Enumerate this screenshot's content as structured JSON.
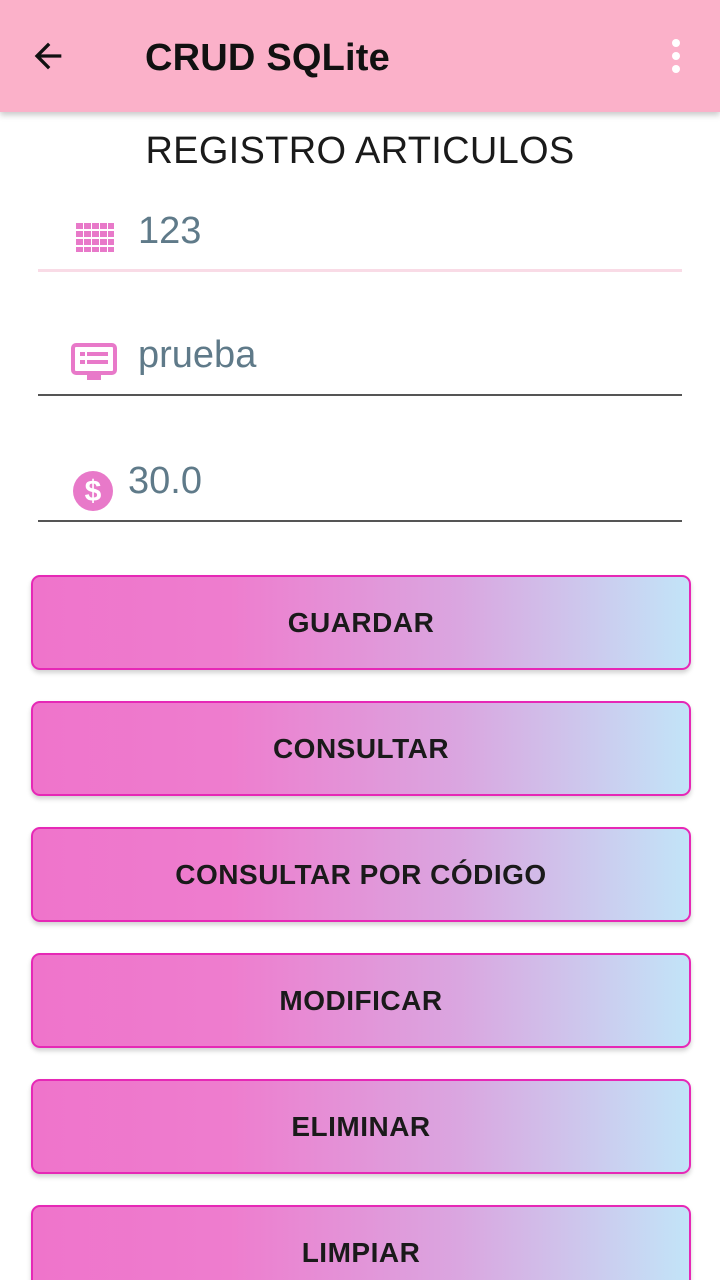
{
  "appbar": {
    "title": "CRUD SQLite",
    "back_icon": "arrow-back-icon",
    "overflow_icon": "more-vert-icon",
    "background": "#fbb1c9"
  },
  "heading": "REGISTRO ARTICULOS",
  "fields": {
    "code": {
      "value": "123",
      "icon": "keypad-grid-icon"
    },
    "description": {
      "value": "prueba",
      "icon": "keyboard-monitor-icon"
    },
    "price": {
      "value": "30.0",
      "icon": "dollar-circle-icon"
    }
  },
  "buttons": {
    "guardar": "GUARDAR",
    "consultar": "CONSULTAR",
    "consultar_codigo": "CONSULTAR POR CÓDIGO",
    "modificar": "MODIFICAR",
    "eliminar": "ELIMINAR",
    "limpiar": "LIMPIAR"
  },
  "colors": {
    "accent_icon": "#e879c9",
    "button_border": "#e628b6",
    "button_gradient_start": "#ef74cb",
    "button_gradient_end": "#c2e4f8",
    "input_text": "#5f7a89"
  }
}
